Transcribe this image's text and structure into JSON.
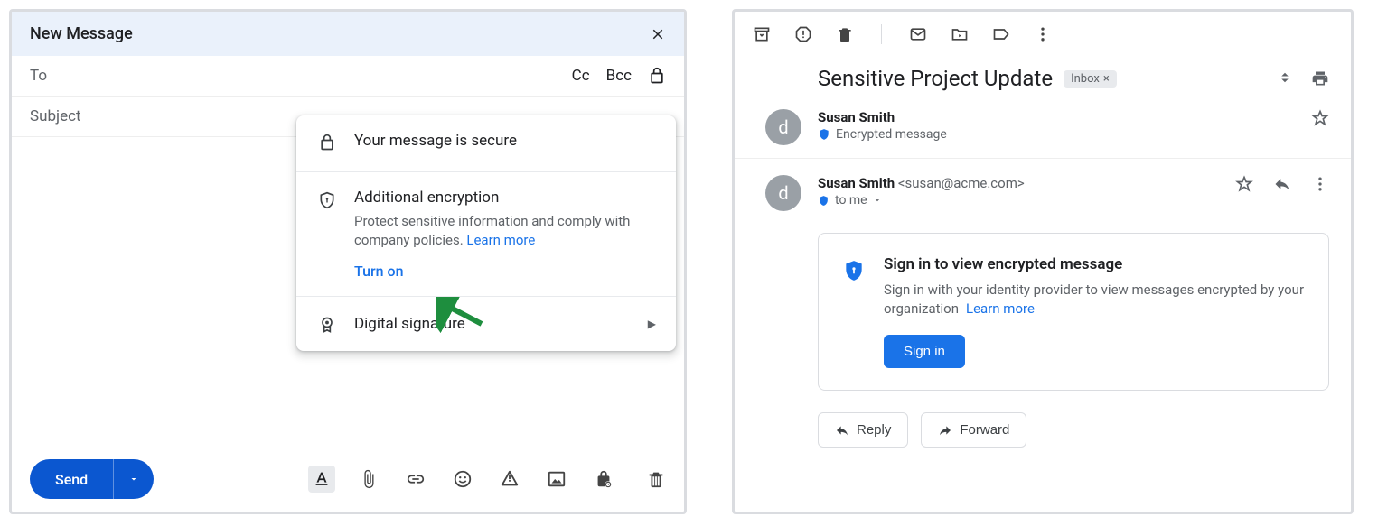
{
  "compose": {
    "title": "New Message",
    "to_label": "To",
    "cc_label": "Cc",
    "bcc_label": "Bcc",
    "subject_placeholder": "Subject",
    "send_label": "Send",
    "popup": {
      "secure_title": "Your message is secure",
      "enc_title": "Additional encryption",
      "enc_desc": "Protect sensitive information and comply with company policies. ",
      "learn_more": "Learn more",
      "turn_on": "Turn on",
      "digital_sig": "Digital signature"
    }
  },
  "reader": {
    "subject": "Sensitive Project Update",
    "chip": "Inbox",
    "sender1_name": "Susan Smith",
    "enc_msg": "Encrypted message",
    "sender2_name": "Susan Smith",
    "sender2_email": "<susan@acme.com>",
    "to_me": "to me",
    "box_title": "Sign in to view encrypted message",
    "box_desc": "Sign in with your identity provider to view messages encrypted by your organization",
    "box_learn": "Learn  more",
    "signin": "Sign in",
    "reply": "Reply",
    "forward": "Forward"
  }
}
